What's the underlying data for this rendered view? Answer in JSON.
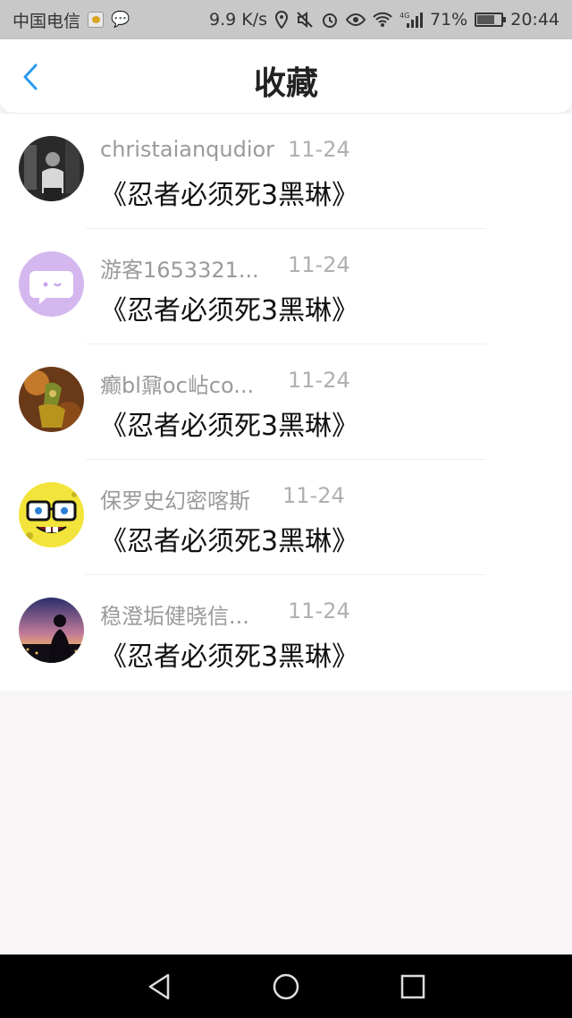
{
  "status_bar": {
    "carrier": "中国电信",
    "network_speed": "9.9 K/s",
    "network_type": "4G",
    "battery": "71%",
    "battery_level": 0.71,
    "time": "20:44"
  },
  "header": {
    "title": "收藏"
  },
  "items": [
    {
      "name": "christaianqudior",
      "date": "11-24",
      "content": "《忍者必须死3黑琳》",
      "avatar": "photo-dark-person"
    },
    {
      "name": "游客1653321...",
      "date": "11-24",
      "content": "《忍者必须死3黑琳》",
      "avatar": "default-chat-avatar"
    },
    {
      "name": "癫bl鼐oc岾co...",
      "date": "11-24",
      "content": "《忍者必须死3黑琳》",
      "avatar": "game-character"
    },
    {
      "name": "保罗史幻密喀斯",
      "date": "11-24",
      "content": "《忍者必须死3黑琳》",
      "avatar": "spongebob-glasses"
    },
    {
      "name": "稳澄垢健晓信...",
      "date": "11-24",
      "content": "《忍者必须死3黑琳》",
      "avatar": "sunset-silhouette"
    }
  ],
  "colors": {
    "accent": "#2b9bf0",
    "page_bg": "#f7f5f6"
  }
}
